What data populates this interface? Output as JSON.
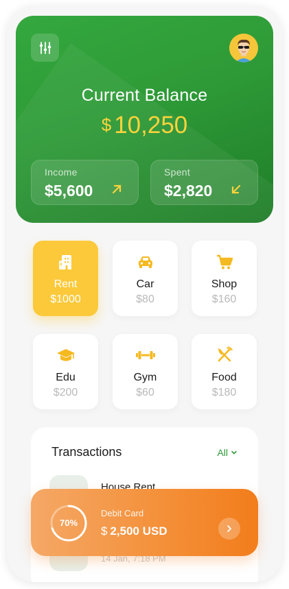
{
  "header": {
    "balance_title": "Current Balance",
    "currency_symbol": "$",
    "balance_amount": "10,250"
  },
  "stats": [
    {
      "label": "Income",
      "value": "$5,600",
      "direction": "up"
    },
    {
      "label": "Spent",
      "value": "$2,820",
      "direction": "down"
    }
  ],
  "categories": [
    {
      "name": "Rent",
      "price": "$1000",
      "icon": "building-icon",
      "active": true
    },
    {
      "name": "Car",
      "price": "$80",
      "icon": "car-icon",
      "active": false
    },
    {
      "name": "Shop",
      "price": "$160",
      "icon": "cart-icon",
      "active": false
    },
    {
      "name": "Edu",
      "price": "$200",
      "icon": "graduation-cap-icon",
      "active": false
    },
    {
      "name": "Gym",
      "price": "$60",
      "icon": "dumbbell-icon",
      "active": false
    },
    {
      "name": "Food",
      "price": "$180",
      "icon": "fork-knife-icon",
      "active": false
    }
  ],
  "transactions": {
    "title": "Transactions",
    "filter_label": "All",
    "items": [
      {
        "name": "House Rent",
        "date": "14 Jan, 7:18 PM"
      }
    ]
  },
  "debit_card": {
    "percent": "70%",
    "progress": 0.7,
    "label": "Debit Card",
    "currency_symbol": "$",
    "amount": "2,500 USD"
  },
  "colors": {
    "primary_green": "#2e9a37",
    "accent_yellow": "#fbc93a",
    "balance_yellow": "#fbd33b",
    "accent_orange": "#f4913b"
  }
}
